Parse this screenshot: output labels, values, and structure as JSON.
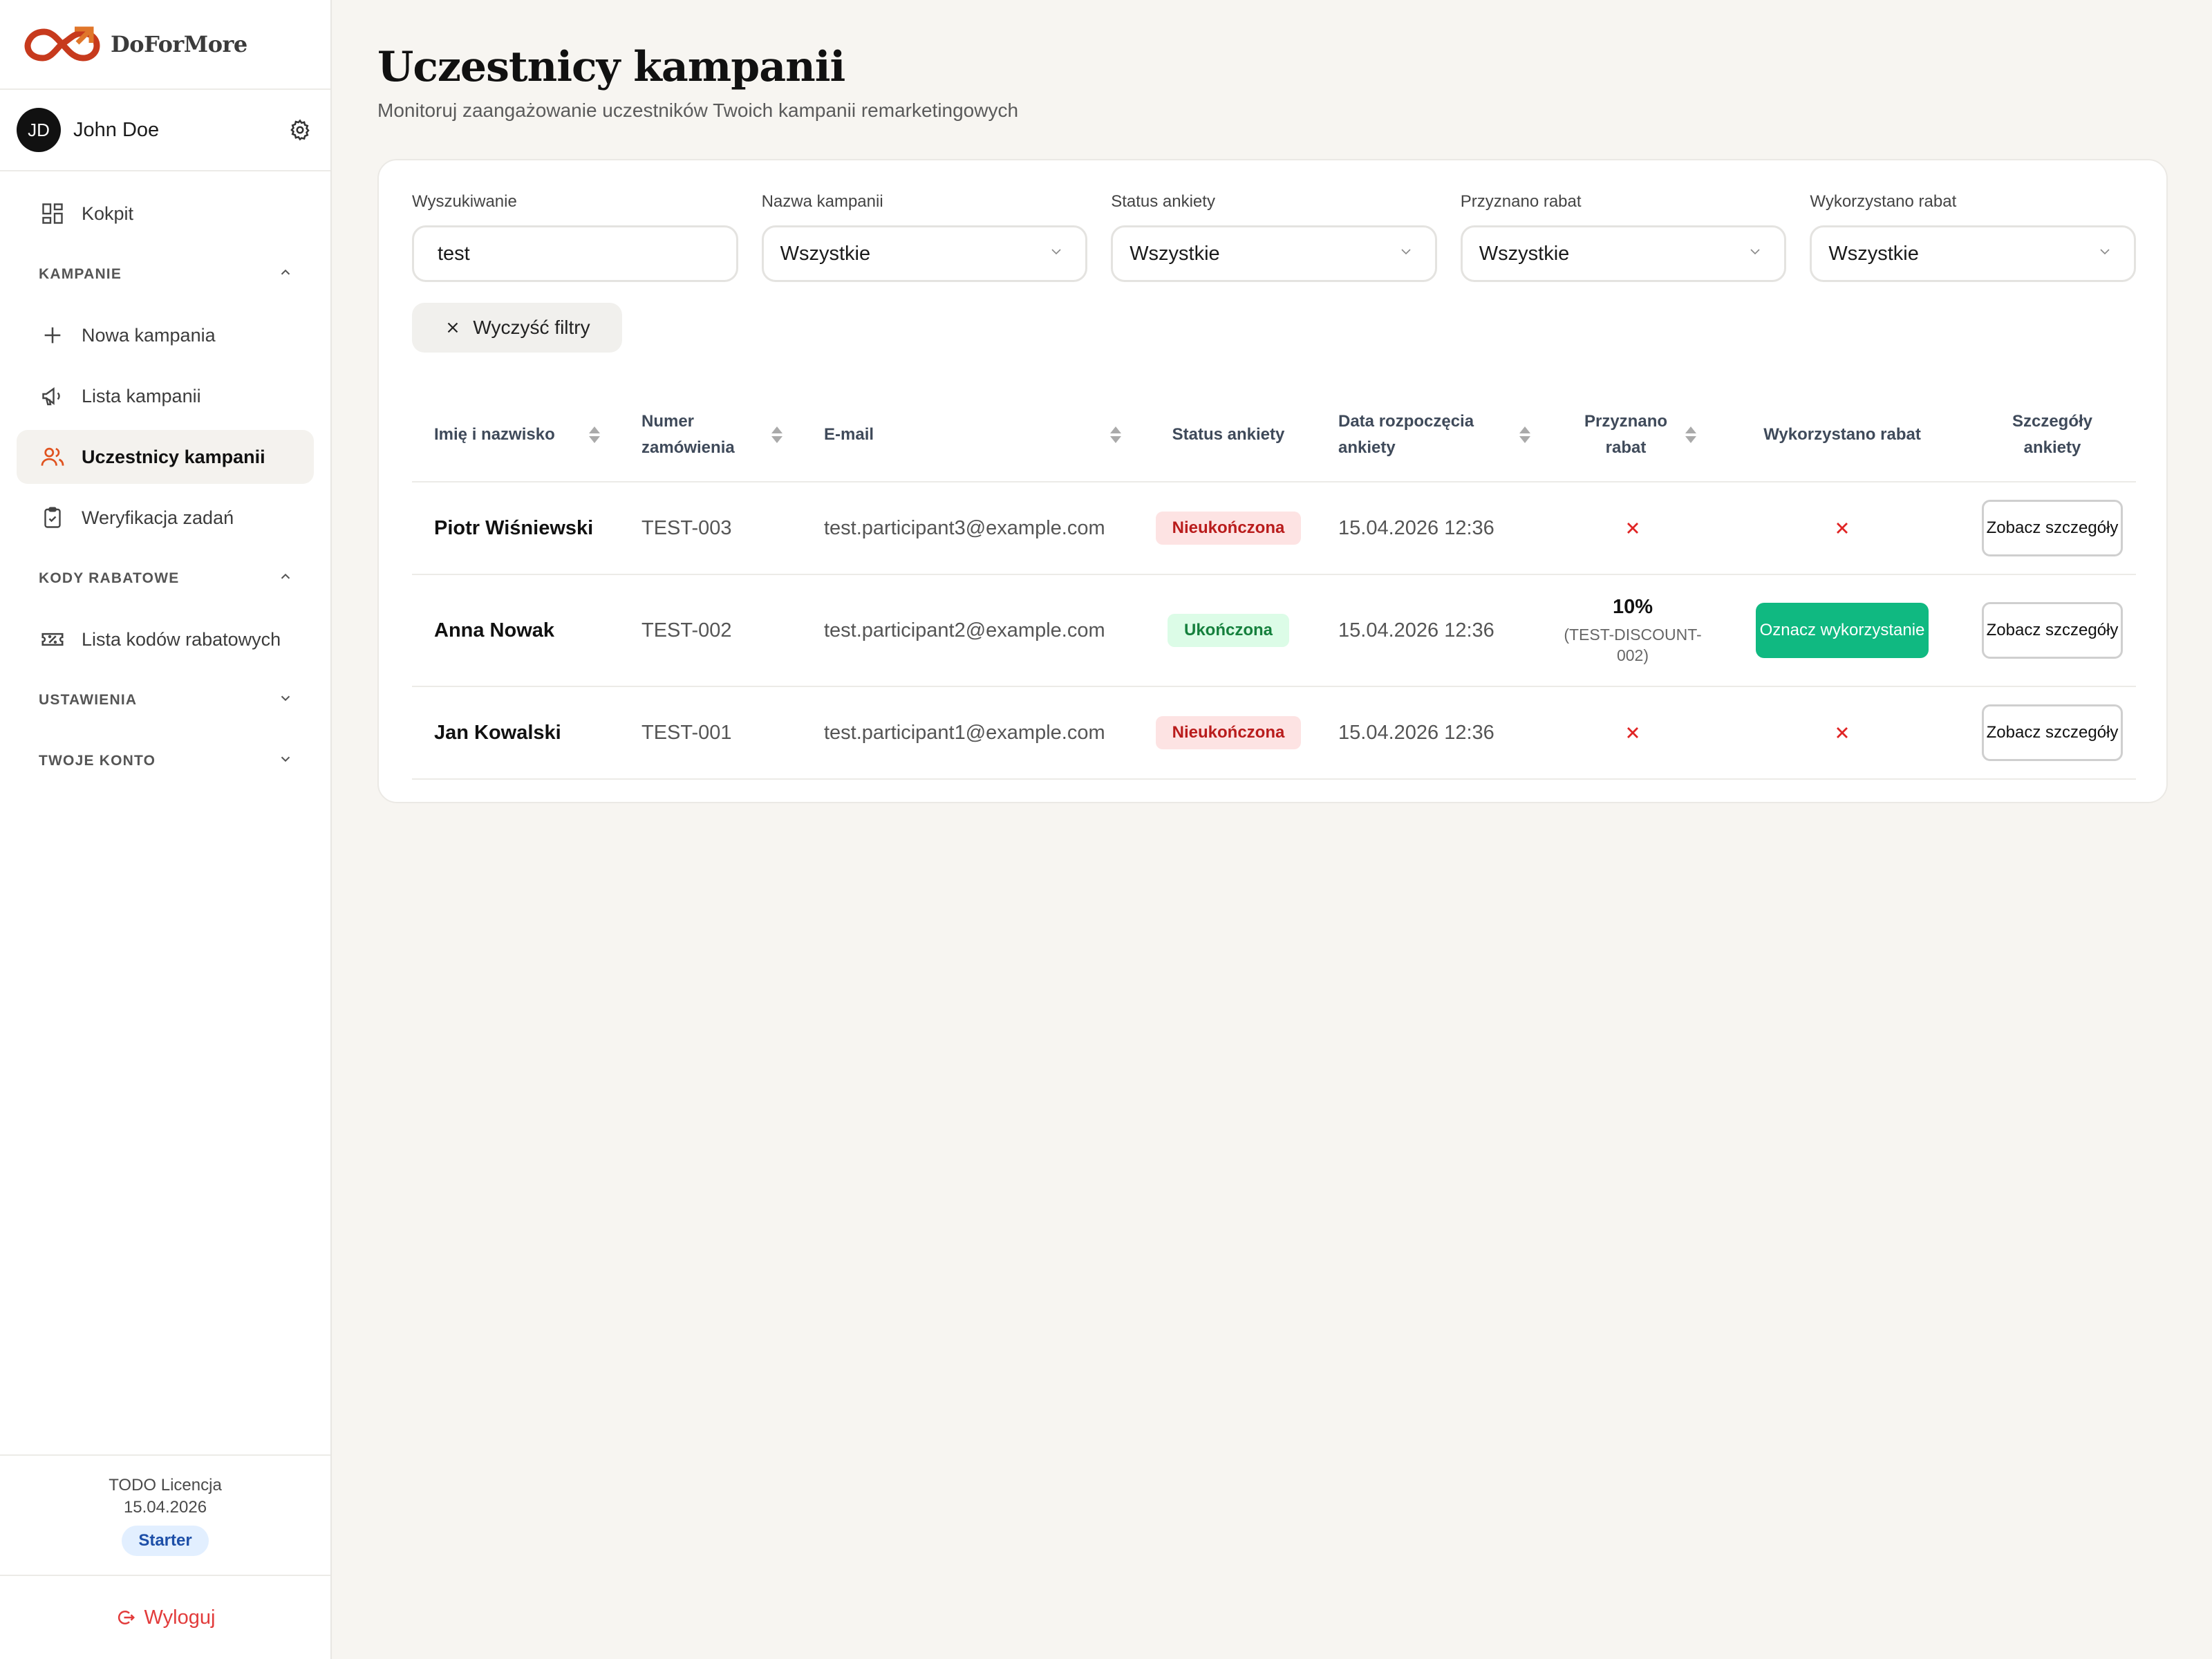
{
  "app": {
    "brand": "DoForMore",
    "brand_color": "#d9411e"
  },
  "user": {
    "initials": "JD",
    "name": "John Doe"
  },
  "sidebar": {
    "items": [
      {
        "label": "Kokpit",
        "icon": "dashboard-icon"
      },
      {
        "label": "KAMPANIE",
        "type": "section",
        "expanded": true
      },
      {
        "label": "Nowa kampania",
        "icon": "plus-icon"
      },
      {
        "label": "Lista kampanii",
        "icon": "megaphone-icon"
      },
      {
        "label": "Uczestnicy kampanii",
        "icon": "users-icon",
        "active": true
      },
      {
        "label": "Weryfikacja zadań",
        "icon": "clipboard-check-icon"
      },
      {
        "label": "KODY RABATOWE",
        "type": "section",
        "expanded": true
      },
      {
        "label": "Lista kodów rabatowych",
        "icon": "ticket-icon"
      },
      {
        "label": "USTAWIENIA",
        "type": "section",
        "expanded": false
      },
      {
        "label": "TWOJE KONTO",
        "type": "section",
        "expanded": false
      }
    ],
    "license": {
      "title": "TODO Licencja",
      "date": "15.04.2026",
      "plan": "Starter"
    },
    "logout_label": "Wyloguj"
  },
  "page": {
    "title": "Uczestnicy kampanii",
    "subtitle": "Monitoruj zaangażowanie uczestników Twoich kampanii remarketingowych"
  },
  "filters": {
    "search": {
      "label": "Wyszukiwanie",
      "value": "test"
    },
    "campaign": {
      "label": "Nazwa kampanii",
      "value": "Wszystkie"
    },
    "survey_status": {
      "label": "Status ankiety",
      "value": "Wszystkie"
    },
    "discount_granted": {
      "label": "Przyznano rabat",
      "value": "Wszystkie"
    },
    "discount_used": {
      "label": "Wykorzystano rabat",
      "value": "Wszystkie"
    },
    "clear_label": "Wyczyść filtry"
  },
  "table": {
    "headers": {
      "name": "Imię i nazwisko",
      "order": "Numer zamówienia",
      "email": "E-mail",
      "status": "Status ankiety",
      "date": "Data rozpoczęcia ankiety",
      "granted": "Przyznano rabat",
      "used": "Wykorzystano rabat",
      "details": "Szczegóły ankiety"
    },
    "rows": [
      {
        "name": "Piotr Wiśniewski",
        "order": "TEST-003",
        "email": "test.participant3@example.com",
        "status": "Nieukończona",
        "date": "15.04.2026 12:36",
        "granted": false,
        "used": false,
        "details_label": "Zobacz szczegóły"
      },
      {
        "name": "Anna Nowak",
        "order": "TEST-002",
        "email": "test.participant2@example.com",
        "status": "Ukończona",
        "date": "15.04.2026 12:36",
        "granted": true,
        "discount_value": "10%",
        "discount_code": "(TEST-DISCOUNT-002)",
        "used": false,
        "mark_label": "Oznacz wykorzystanie",
        "details_label": "Zobacz szczegóły"
      },
      {
        "name": "Jan Kowalski",
        "order": "TEST-001",
        "email": "test.participant1@example.com",
        "status": "Nieukończona",
        "date": "15.04.2026 12:36",
        "granted": false,
        "used": false,
        "details_label": "Zobacz szczegóły"
      }
    ]
  },
  "colors": {
    "success": "#10b981",
    "danger": "#e02424",
    "badge_red_bg": "#fde3e3",
    "badge_green_bg": "#dcfce7"
  }
}
